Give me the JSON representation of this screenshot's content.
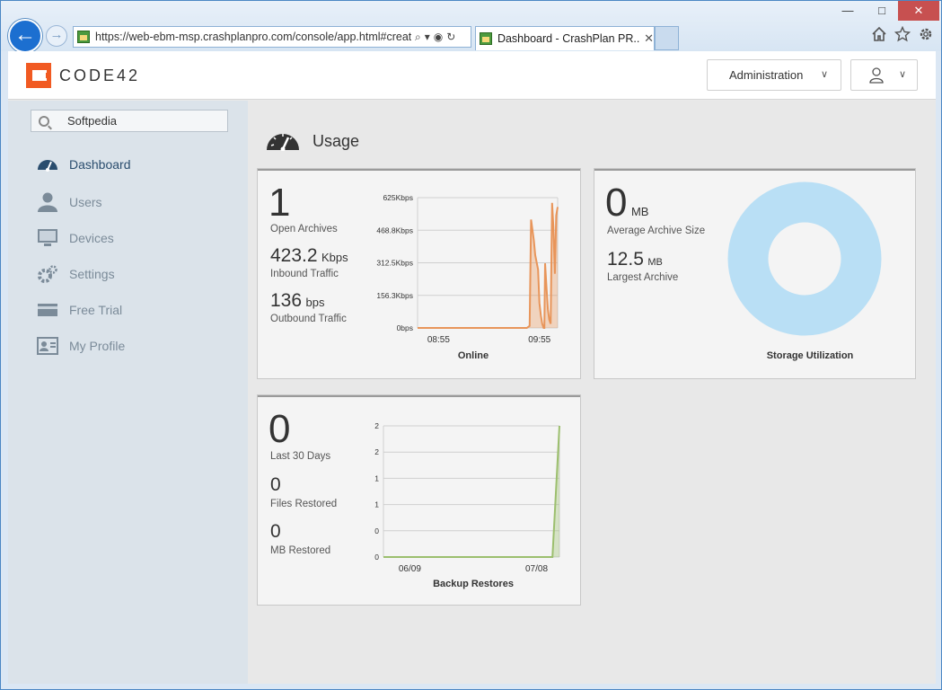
{
  "browser": {
    "address": "https://web-ebm-msp.crashplanpro.com/console/app.html#creat",
    "tab_title": "Dashboard - CrashPlan PR...",
    "tab_close": "✕",
    "window_controls": {
      "minimize": "—",
      "maximize": "□",
      "close": "✕"
    },
    "addr_icons": [
      "⌕",
      "▾",
      "🔒",
      "↻"
    ],
    "tool_icons": [
      "home-icon",
      "star-icon",
      "gear-icon"
    ]
  },
  "header": {
    "brand": "CODE42",
    "admin_label": "Administration",
    "chevron": "∨"
  },
  "sidebar": {
    "search_value": "Softpedia",
    "items": [
      {
        "label": "Dashboard",
        "icon": "dashboard-icon",
        "active": true
      },
      {
        "label": "Users",
        "icon": "user-icon",
        "active": false
      },
      {
        "label": "Devices",
        "icon": "monitor-icon",
        "active": false
      },
      {
        "label": "Settings",
        "icon": "gear-icon",
        "active": false
      },
      {
        "label": "Free Trial",
        "icon": "card-icon",
        "active": false
      },
      {
        "label": "My Profile",
        "icon": "profile-card-icon",
        "active": false
      }
    ]
  },
  "main": {
    "title": "Usage",
    "archives": {
      "open_archives_value": "1",
      "open_archives_label": "Open Archives",
      "inbound_value": "423.2",
      "inbound_unit": "Kbps",
      "inbound_label": "Inbound Traffic",
      "outbound_value": "136",
      "outbound_unit": "bps",
      "outbound_label": "Outbound Traffic"
    },
    "storage": {
      "avg_value": "0",
      "avg_unit": "MB",
      "avg_label": "Average Archive Size",
      "largest_value": "12.5",
      "largest_unit": "MB",
      "largest_label": "Largest Archive",
      "donut_color": "#b9dff5"
    },
    "restores": {
      "last30_value": "0",
      "last30_label": "Last 30 Days",
      "files_value": "0",
      "files_label": "Files Restored",
      "mb_value": "0",
      "mb_label": "MB Restored"
    }
  },
  "chart_data": [
    {
      "type": "area",
      "title": "Online",
      "y_ticks": [
        "625Kbps",
        "468.8Kbps",
        "312.5Kbps",
        "156.3Kbps",
        "0bps"
      ],
      "ylim": [
        0,
        625
      ],
      "x_ticks": [
        "08:55",
        "09:55"
      ],
      "color": "#e8955a",
      "x": [
        0,
        0.6,
        0.78,
        0.8,
        0.81,
        0.83,
        0.84,
        0.86,
        0.87,
        0.88,
        0.89,
        0.9,
        0.905,
        0.91,
        0.92,
        0.93,
        0.94,
        0.95,
        0.96,
        0.97,
        0.98,
        0.99,
        1.0
      ],
      "values": [
        0,
        0,
        0,
        10,
        520,
        420,
        350,
        280,
        120,
        60,
        20,
        0,
        0,
        310,
        200,
        90,
        40,
        20,
        600,
        480,
        260,
        540,
        580
      ]
    },
    {
      "type": "area",
      "title": "Storage Utilization",
      "subtype": "donut",
      "values": [
        1
      ],
      "color": "#b9dff5"
    },
    {
      "type": "area",
      "title": "Backup Restores",
      "y_ticks": [
        "2",
        "2",
        "1",
        "1",
        "0",
        "0"
      ],
      "ylim": [
        0,
        2
      ],
      "x_ticks": [
        "06/09",
        "07/08"
      ],
      "color": "#9cbf6e",
      "x": [
        0,
        0.93,
        0.96,
        1.0
      ],
      "values": [
        0,
        0,
        0,
        2
      ]
    }
  ]
}
